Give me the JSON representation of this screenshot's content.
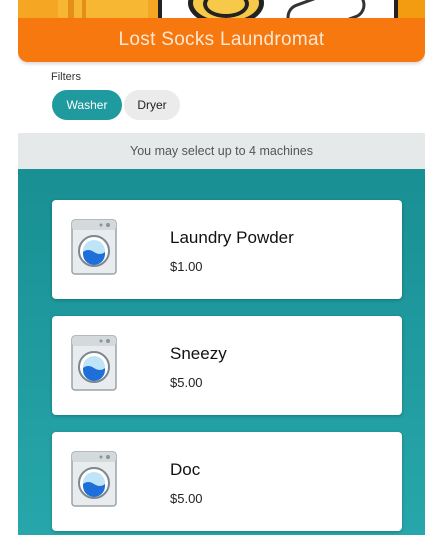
{
  "app": {
    "title": "Lost Socks Laundromat"
  },
  "filters": {
    "label": "Filters",
    "options": [
      {
        "label": "Washer",
        "selected": true
      },
      {
        "label": "Dryer",
        "selected": false
      }
    ]
  },
  "notice": "You may select up to 4 machines",
  "machines": [
    {
      "name": "Laundry Powder",
      "price": "$1.00",
      "icon": "washing-machine-icon"
    },
    {
      "name": "Sneezy",
      "price": "$5.00",
      "icon": "washing-machine-icon"
    },
    {
      "name": "Doc",
      "price": "$5.00",
      "icon": "washing-machine-icon"
    }
  ],
  "colors": {
    "header": "#f7780f",
    "accent": "#1f9a9e",
    "list_background": "#188f93"
  }
}
